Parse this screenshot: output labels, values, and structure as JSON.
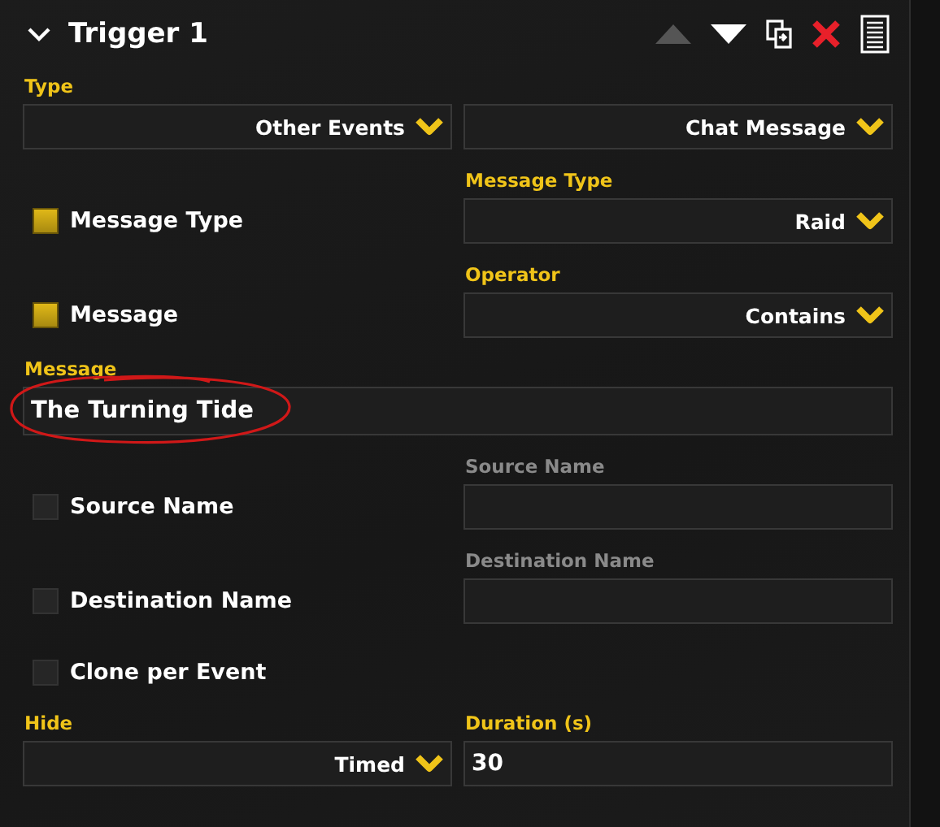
{
  "trigger": {
    "title": "Trigger 1",
    "expanded": true
  },
  "toolbar": [
    {
      "kind": "up",
      "disabled": true
    },
    {
      "kind": "down",
      "disabled": false
    },
    {
      "kind": "duplicate",
      "disabled": false
    },
    {
      "kind": "delete",
      "disabled": false
    },
    {
      "kind": "menu",
      "disabled": false
    }
  ],
  "rows": [
    {
      "kind": "dropdowns",
      "label": "Type",
      "values": [
        "Other Events",
        "Chat Message"
      ]
    },
    {
      "kind": "option",
      "checkbox": {
        "label": "Message Type",
        "checked": true
      },
      "field": {
        "kind": "dropdown",
        "label": "Message Type",
        "value": "Raid",
        "disabled": false
      }
    },
    {
      "kind": "option",
      "checkbox": {
        "label": "Message",
        "checked": true
      },
      "field": {
        "kind": "dropdown",
        "label": "Operator",
        "value": "Contains",
        "disabled": false
      }
    },
    {
      "kind": "text",
      "label": "Message",
      "value": "The Turning Tide",
      "circled": true
    },
    {
      "kind": "option",
      "checkbox": {
        "label": "Source Name",
        "checked": false
      },
      "field": {
        "kind": "input",
        "label": "Source Name",
        "disabled": true
      }
    },
    {
      "kind": "option",
      "checkbox": {
        "label": "Destination Name",
        "checked": false
      },
      "field": {
        "kind": "input",
        "label": "Destination Name",
        "disabled": true
      }
    },
    {
      "kind": "check",
      "checkbox": {
        "label": "Clone per Event",
        "checked": false
      }
    },
    {
      "kind": "pair",
      "fields": [
        {
          "kind": "dropdown",
          "label": "Hide",
          "value": "Timed",
          "disabled": false
        },
        {
          "kind": "input",
          "label": "Duration (s)",
          "value": "30",
          "disabled": false
        }
      ]
    }
  ]
}
